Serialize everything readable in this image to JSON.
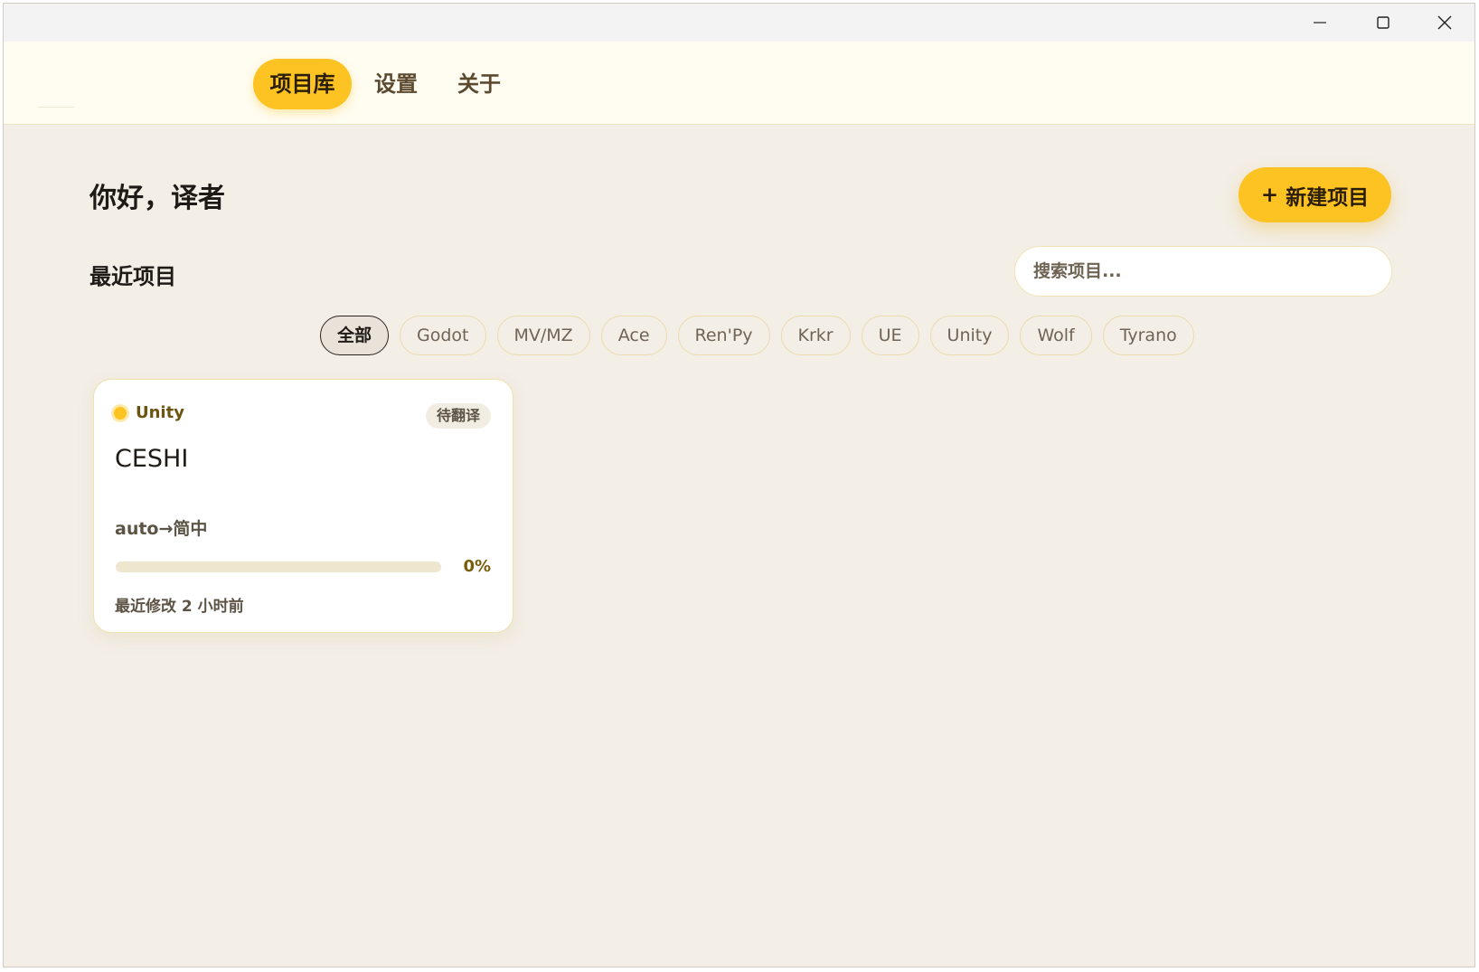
{
  "titlebar": {
    "minimize_icon": "minimize-icon",
    "maximize_icon": "maximize-icon",
    "close_icon": "close-icon"
  },
  "nav": {
    "tabs": [
      {
        "label": "项目库",
        "active": true
      },
      {
        "label": "设置",
        "active": false
      },
      {
        "label": "关于",
        "active": false
      }
    ]
  },
  "main": {
    "greeting": "你好，译者",
    "new_project_plus": "+",
    "new_project_label": "新建项目",
    "section_title": "最近项目",
    "search_placeholder": "搜索项目..."
  },
  "filters": {
    "chips": [
      "全部",
      "Godot",
      "MV/MZ",
      "Ace",
      "Ren'Py",
      "Krkr",
      "UE",
      "Unity",
      "Wolf",
      "Tyrano"
    ],
    "active": "全部"
  },
  "projects": [
    {
      "engine": "Unity",
      "status": "待翻译",
      "name": "CESHI",
      "lang_pair": "auto→简中",
      "progress": 0,
      "progress_text": "0%",
      "modified": "最近修改 2 小时前"
    }
  ],
  "colors": {
    "accent": "#fdc322",
    "background": "#f3eee6",
    "nav_background": "#fffcf1"
  }
}
